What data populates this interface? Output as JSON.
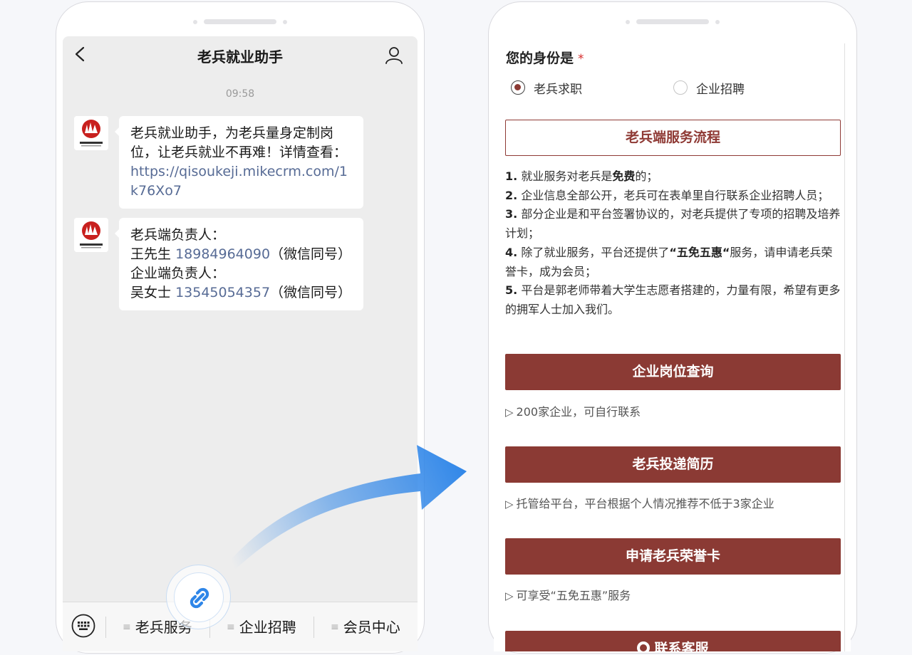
{
  "chat": {
    "title": "老兵就业助手",
    "time": "09:58",
    "messages": [
      {
        "line1": "老兵就业助手，为老兵量身定制岗位，让老兵就业不再难！详情查看：",
        "link": "https://qisoukeji.mikecrm.com/1k76Xo7"
      },
      {
        "veteran_label": "老兵端负责人：",
        "veteran_name": "王先生",
        "veteran_phone": "18984964090",
        "veteran_note": "（微信同号）",
        "company_label": "企业端负责人：",
        "company_name": "吴女士",
        "company_phone": "13545054357",
        "company_note": "（微信同号）"
      }
    ],
    "menu": [
      {
        "label": "老兵服务"
      },
      {
        "label": "企业招聘"
      },
      {
        "label": "会员中心"
      }
    ]
  },
  "form": {
    "identity_label": "您的身份是",
    "required_mark": "*",
    "options": [
      {
        "label": "老兵求职",
        "checked": true
      },
      {
        "label": "企业招聘",
        "checked": false
      }
    ],
    "flow_title": "老兵端服务流程",
    "flow_items": [
      {
        "num": "1.",
        "pre": "就业服务对老兵是",
        "bold": "免费",
        "post": "的；"
      },
      {
        "num": "2.",
        "pre": "企业信息全部公开，老兵可在表单里自行联系企业招聘人员；",
        "bold": "",
        "post": ""
      },
      {
        "num": "3.",
        "pre": "部分企业是和平台签署协议的，对老兵提供了专项的招聘及培养计划；",
        "bold": "",
        "post": ""
      },
      {
        "num": "4.",
        "pre": "除了就业服务，平台还提供了",
        "bold": "“五免五惠“",
        "post": "服务，请申请老兵荣誉卡，成为会员；"
      },
      {
        "num": "5.",
        "pre": "平台是郭老师带着大学生志愿者搭建的，力量有限，希望有更多的拥军人士加入我们。",
        "bold": "",
        "post": ""
      }
    ],
    "actions": [
      {
        "label": "企业岗位查询",
        "desc": "200家企业，可自行联系"
      },
      {
        "label": "老兵投递简历",
        "desc": "托管给平台，平台根据个人情况推荐不低于3家企业"
      },
      {
        "label": "申请老兵荣誉卡",
        "desc": "可享受“五免五惠”服务"
      },
      {
        "label": "联系客服",
        "desc": ""
      }
    ],
    "desc_prefix": "▷"
  },
  "colors": {
    "accent": "#8b3a34",
    "link": "#576b95",
    "arrow": "#2f86e8"
  }
}
